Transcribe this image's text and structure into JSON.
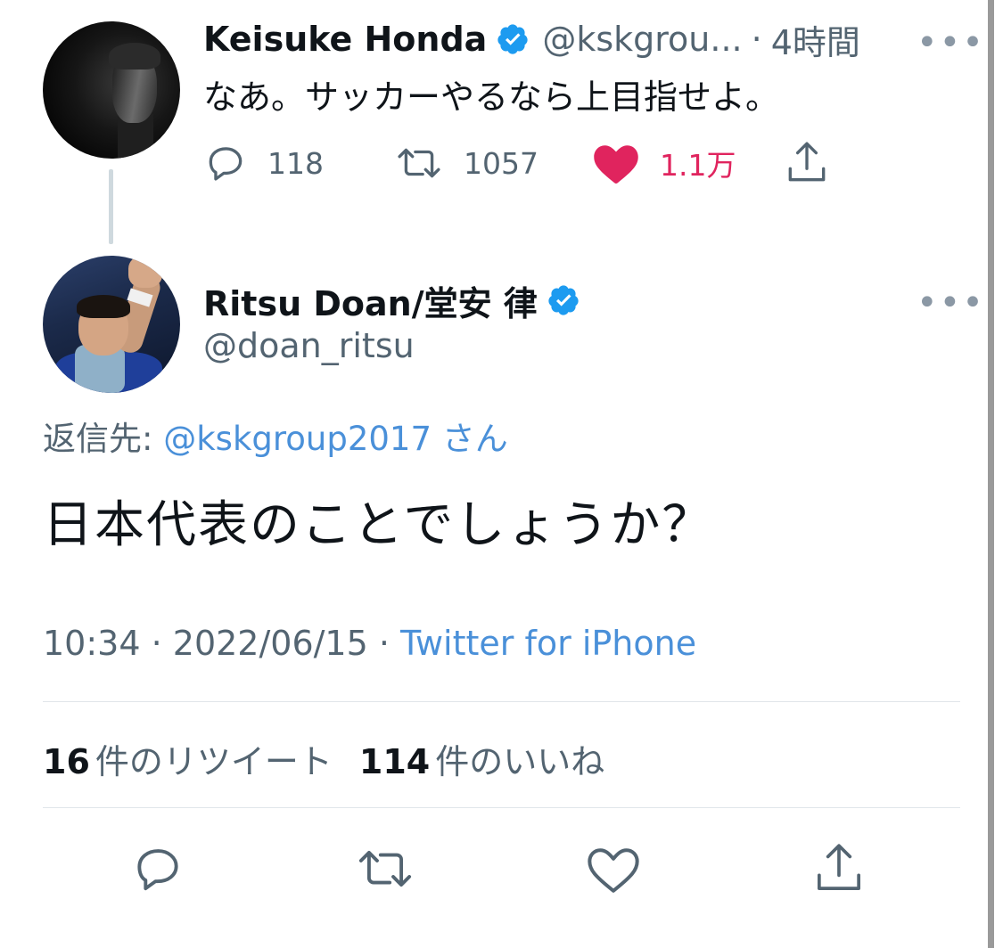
{
  "parent_tweet": {
    "display_name": "Keisuke Honda",
    "handle": "@kskgrou...",
    "separator": "·",
    "time": "4時間",
    "more": "•••",
    "text": "なあ。サッカーやるなら上目指せよ。",
    "actions": {
      "reply_count": "118",
      "retweet_count": "1057",
      "like_count": "1.1万"
    }
  },
  "main_tweet": {
    "display_name": "Ritsu Doan/堂安 律",
    "handle": "@doan_ritsu",
    "more": "•••",
    "reply_prefix": "返信先: ",
    "reply_mention": "@kskgroup2017",
    "reply_suffix": " さん",
    "text": "日本代表のことでしょうか？",
    "time": "10:34",
    "separator": " · ",
    "date": "2022/06/15",
    "source": "Twitter for iPhone",
    "retweets_num": "16",
    "retweets_label": "件のリツイート",
    "likes_num": "114",
    "likes_label": "件のいいね"
  },
  "colors": {
    "verified": "#1d9bf0",
    "like": "#e0245e",
    "link": "#4a90d9",
    "secondary_text": "#536471"
  },
  "icons": {
    "reply": "speech-bubble-icon",
    "retweet": "retweet-arrows-icon",
    "like": "heart-icon",
    "share": "share-upload-icon",
    "verified": "verified-badge-icon"
  }
}
